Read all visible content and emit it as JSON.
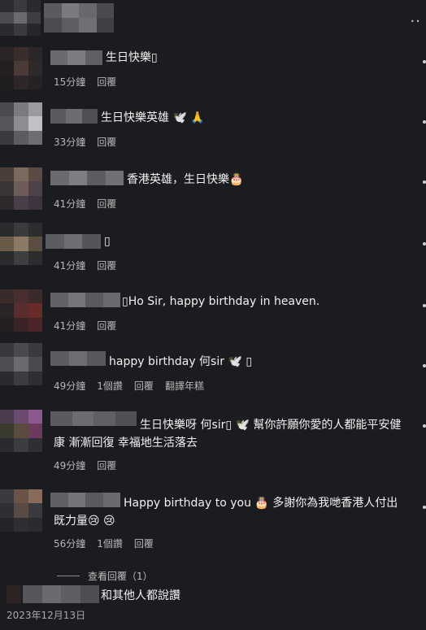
{
  "comments": [
    {
      "text": "生日快樂▯",
      "time": "15分鐘",
      "reply": "回覆"
    },
    {
      "text": "生日快樂英雄 🕊️ 🙏",
      "time": "33分鐘",
      "reply": "回覆"
    },
    {
      "text": "香港英雄，生日快樂🎂",
      "time": "41分鐘",
      "reply": "回覆"
    },
    {
      "text": "▯",
      "time": "41分鐘",
      "reply": "回覆"
    },
    {
      "text": "▯Ho Sir, happy birthday in heaven.",
      "time": "41分鐘",
      "reply": "回覆"
    },
    {
      "text": "happy birthday 何sir 🕊️ ▯",
      "time": "49分鐘",
      "likes": "1個讚",
      "reply": "回覆",
      "translate": "翻譯年糕"
    },
    {
      "text": "生日快樂呀 何sir▯ 🕊️ 幫你許願你愛的人都能平安健康 漸漸回復 幸福地生活落去",
      "time": "49分鐘",
      "reply": "回覆"
    },
    {
      "text": "Happy birthday to you 🎂 多謝你為我哋香港人付出既力量😢 😢",
      "time": "56分鐘",
      "likes": "1個讚",
      "reply": "回覆"
    }
  ],
  "view_replies": "查看回覆（1）",
  "likes_line": "和其他人都說讚",
  "date": "2023年12月13日"
}
